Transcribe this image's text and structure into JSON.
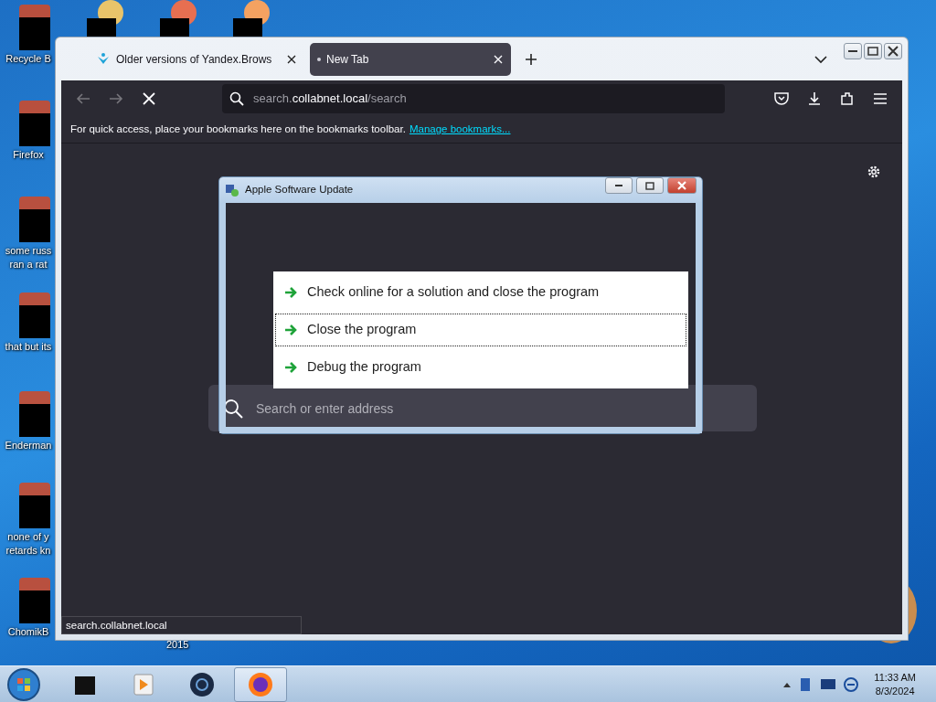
{
  "desktop_icons": [
    {
      "lines": [
        "Recycle B"
      ]
    },
    {
      "lines": [
        "Firefox"
      ]
    },
    {
      "lines": [
        "some russ",
        "ran a rat"
      ]
    },
    {
      "lines": [
        "that but its"
      ]
    },
    {
      "lines": [
        "Enderman"
      ]
    },
    {
      "lines": [
        "none of y",
        "retards kn"
      ]
    },
    {
      "lines": [
        "ChomikB"
      ]
    }
  ],
  "desktop_text": "2015",
  "browser": {
    "tabs": [
      {
        "title": "Older versions of Yandex.Brows",
        "selected": false
      },
      {
        "title": "New Tab",
        "selected": true
      }
    ],
    "url": {
      "prefix": "search.",
      "domain": "collabnet.local",
      "path": "/search"
    },
    "bookmarks_hint": "For quick access, place your bookmarks here on the bookmarks toolbar.",
    "bookmarks_link": "Manage bookmarks...",
    "search_placeholder": "Search or enter address",
    "status_text": "search.collabnet.local"
  },
  "dialog": {
    "title": "Apple Software Update",
    "options": [
      {
        "label": "Check online for a solution and close the program",
        "selected": false
      },
      {
        "label": "Close the program",
        "selected": true
      },
      {
        "label": "Debug the program",
        "selected": false
      }
    ]
  },
  "taskbar": {
    "apps": [
      {
        "selected": false
      },
      {
        "selected": false
      },
      {
        "selected": false
      },
      {
        "selected": true
      }
    ],
    "time": "11:33 AM",
    "date": "8/3/2024"
  }
}
